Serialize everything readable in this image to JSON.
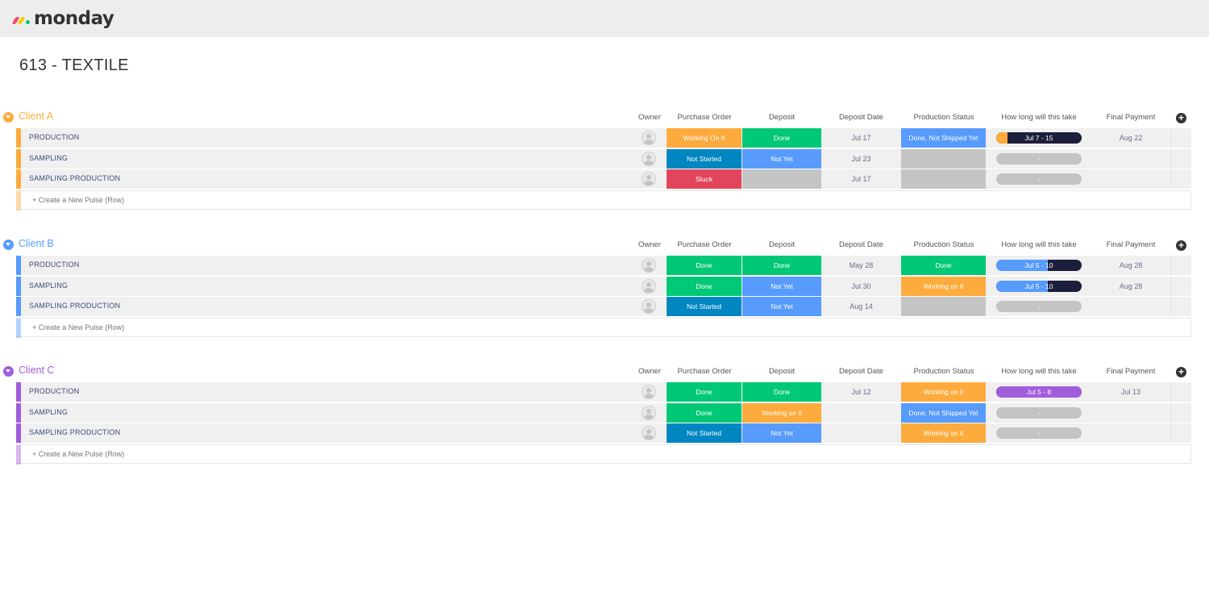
{
  "app": {
    "logo_text": "monday"
  },
  "board": {
    "title": "613 - TEXTILE"
  },
  "columns": {
    "owner": "Owner",
    "purchase_order": "Purchase Order",
    "deposit": "Deposit",
    "deposit_date": "Deposit Date",
    "production_status": "Production Status",
    "how_long": "How long will this take",
    "final_payment": "Final Payment"
  },
  "new_row_label": "+ Create a New Pulse (Row)",
  "colors": {
    "client_a": "#fdab3d",
    "client_b": "#579bfc",
    "client_c": "#a25ddc",
    "working_on_it": "#fdab3d",
    "done": "#00c875",
    "stuck": "#e2445c",
    "not_started": "#0086c0",
    "not_yet": "#579bfc",
    "empty": "#c4c4c4",
    "timeline_dark": "#1c1f3b"
  },
  "groups": [
    {
      "name": "Client A",
      "rows": [
        {
          "name": "PRODUCTION",
          "po": "Working On It",
          "deposit": "Done",
          "deposit_date": "Jul 17",
          "prod": "Done, Not Shipped Yet",
          "timeline": "Jul 7 - 15",
          "final": "Aug 22"
        },
        {
          "name": "SAMPLING",
          "po": "Not Started",
          "deposit": "Not Yet",
          "deposit_date": "Jul 23",
          "prod": "",
          "timeline": "-",
          "final": ""
        },
        {
          "name": "SAMPLING PRODUCTION",
          "po": "Stuck",
          "deposit": "",
          "deposit_date": "Jul 17",
          "prod": "",
          "timeline": "-",
          "final": ""
        }
      ]
    },
    {
      "name": "Client B",
      "rows": [
        {
          "name": "PRODUCTION",
          "po": "Done",
          "deposit": "Done",
          "deposit_date": "May 28",
          "prod": "Done",
          "timeline": "Jul 5 - 10",
          "final": "Aug 28"
        },
        {
          "name": "SAMPLING",
          "po": "Done",
          "deposit": "Not Yet",
          "deposit_date": "Jul 30",
          "prod": "Working on it",
          "timeline": "Jul 5 - 10",
          "final": "Aug 28"
        },
        {
          "name": "SAMPLING PRODUCTION",
          "po": "Not Started",
          "deposit": "Not Yet",
          "deposit_date": "Aug 14",
          "prod": "",
          "timeline": "-",
          "final": ""
        }
      ]
    },
    {
      "name": "Client C",
      "rows": [
        {
          "name": "PRODUCTION",
          "po": "Done",
          "deposit": "Done",
          "deposit_date": "Jul 12",
          "prod": "Working on it",
          "timeline": "Jul 5 - 8",
          "final": "Jul 13"
        },
        {
          "name": "SAMPLING",
          "po": "Done",
          "deposit": "Working on it",
          "deposit_date": "",
          "prod": "Done, Not Shipped Yet",
          "timeline": "-",
          "final": ""
        },
        {
          "name": "SAMPLING PRODUCTION",
          "po": "Not Started",
          "deposit": "Not Yet",
          "deposit_date": "",
          "prod": "Working on it",
          "timeline": "-",
          "final": ""
        }
      ]
    }
  ]
}
